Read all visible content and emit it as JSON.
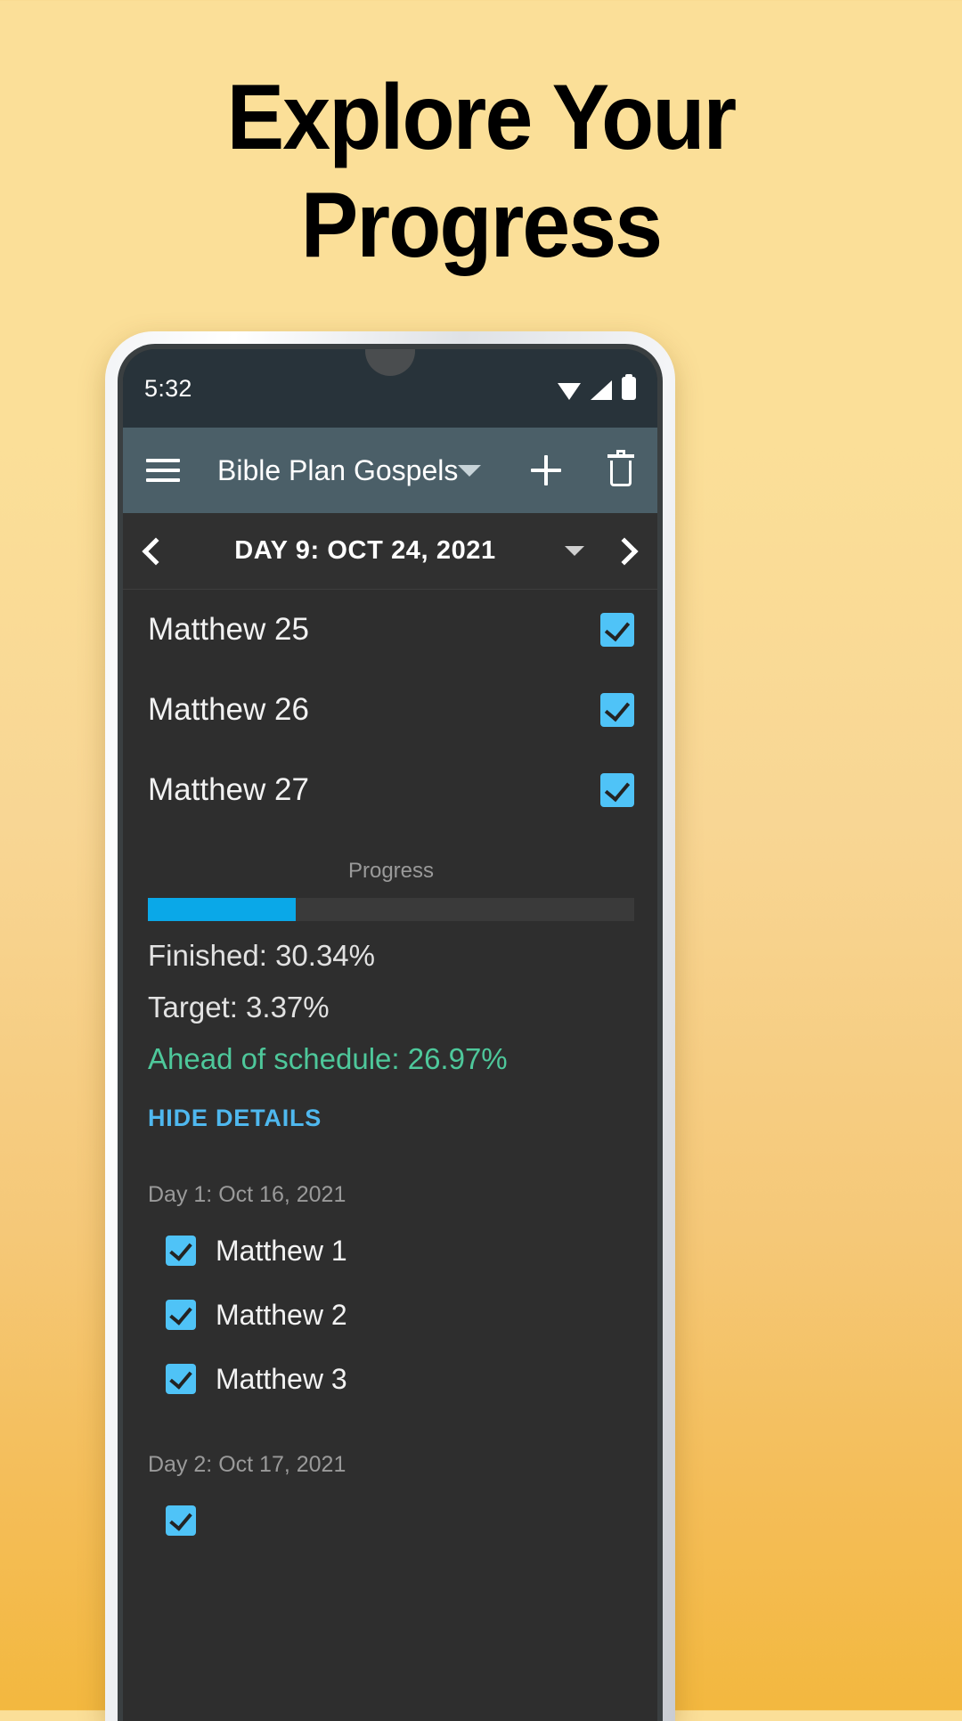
{
  "promo": {
    "line1": "Explore Your",
    "line2": "Progress"
  },
  "colors": {
    "accent_blue": "#4fc3f7",
    "progress_fill": "#0aa8e8",
    "ahead_green": "#4ec89b",
    "appbar": "#4b5f68",
    "statusbar": "#28333a",
    "screen_bg": "#2e2e2e"
  },
  "status_bar": {
    "time": "5:32",
    "icons": [
      "wifi-icon",
      "signal-icon",
      "battery-icon"
    ]
  },
  "appbar": {
    "menu_icon": "hamburger-menu-icon",
    "title": "Bible Plan Gospels",
    "dropdown_icon": "chevron-down-icon",
    "add_icon": "plus-icon",
    "delete_icon": "trash-icon"
  },
  "day_nav": {
    "prev_icon": "chevron-left-icon",
    "title": "DAY 9: OCT 24, 2021",
    "dropdown_icon": "chevron-down-icon",
    "next_icon": "chevron-right-icon"
  },
  "today_chapters": [
    {
      "label": "Matthew 25",
      "checked": true
    },
    {
      "label": "Matthew 26",
      "checked": true
    },
    {
      "label": "Matthew 27",
      "checked": true
    }
  ],
  "progress": {
    "label": "Progress",
    "percent": 30.34,
    "finished": "Finished: 30.34%",
    "target": "Target: 3.37%",
    "ahead": "Ahead of schedule: 26.97%",
    "toggle_label": "HIDE DETAILS"
  },
  "details": [
    {
      "day_label": "Day 1: Oct 16, 2021",
      "items": [
        {
          "label": "Matthew 1",
          "checked": true
        },
        {
          "label": "Matthew 2",
          "checked": true
        },
        {
          "label": "Matthew 3",
          "checked": true
        }
      ]
    },
    {
      "day_label": "Day 2: Oct 17, 2021",
      "items": []
    }
  ]
}
